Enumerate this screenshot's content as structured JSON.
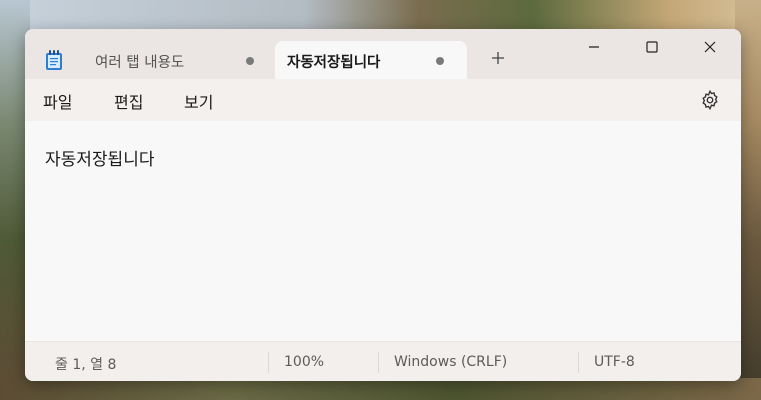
{
  "tabs": [
    {
      "label": "여러 탭 내용도",
      "active": false
    },
    {
      "label": "자동저장됩니다",
      "active": true
    }
  ],
  "menu": {
    "file": "파일",
    "edit": "편집",
    "view": "보기"
  },
  "editor": {
    "content": "자동저장됩니다"
  },
  "status": {
    "position": "줄 1, 열 8",
    "zoom": "100%",
    "line_ending": "Windows (CRLF)",
    "encoding": "UTF-8"
  },
  "icons": {
    "app": "notepad-icon",
    "new_tab": "plus-icon",
    "minimize": "minimize-icon",
    "maximize": "maximize-icon",
    "close": "close-icon",
    "settings": "gear-icon"
  },
  "colors": {
    "titlebar": "#ebe5e3",
    "editor_bg": "#f9f8f8",
    "app_icon": "#2f7fd1"
  }
}
